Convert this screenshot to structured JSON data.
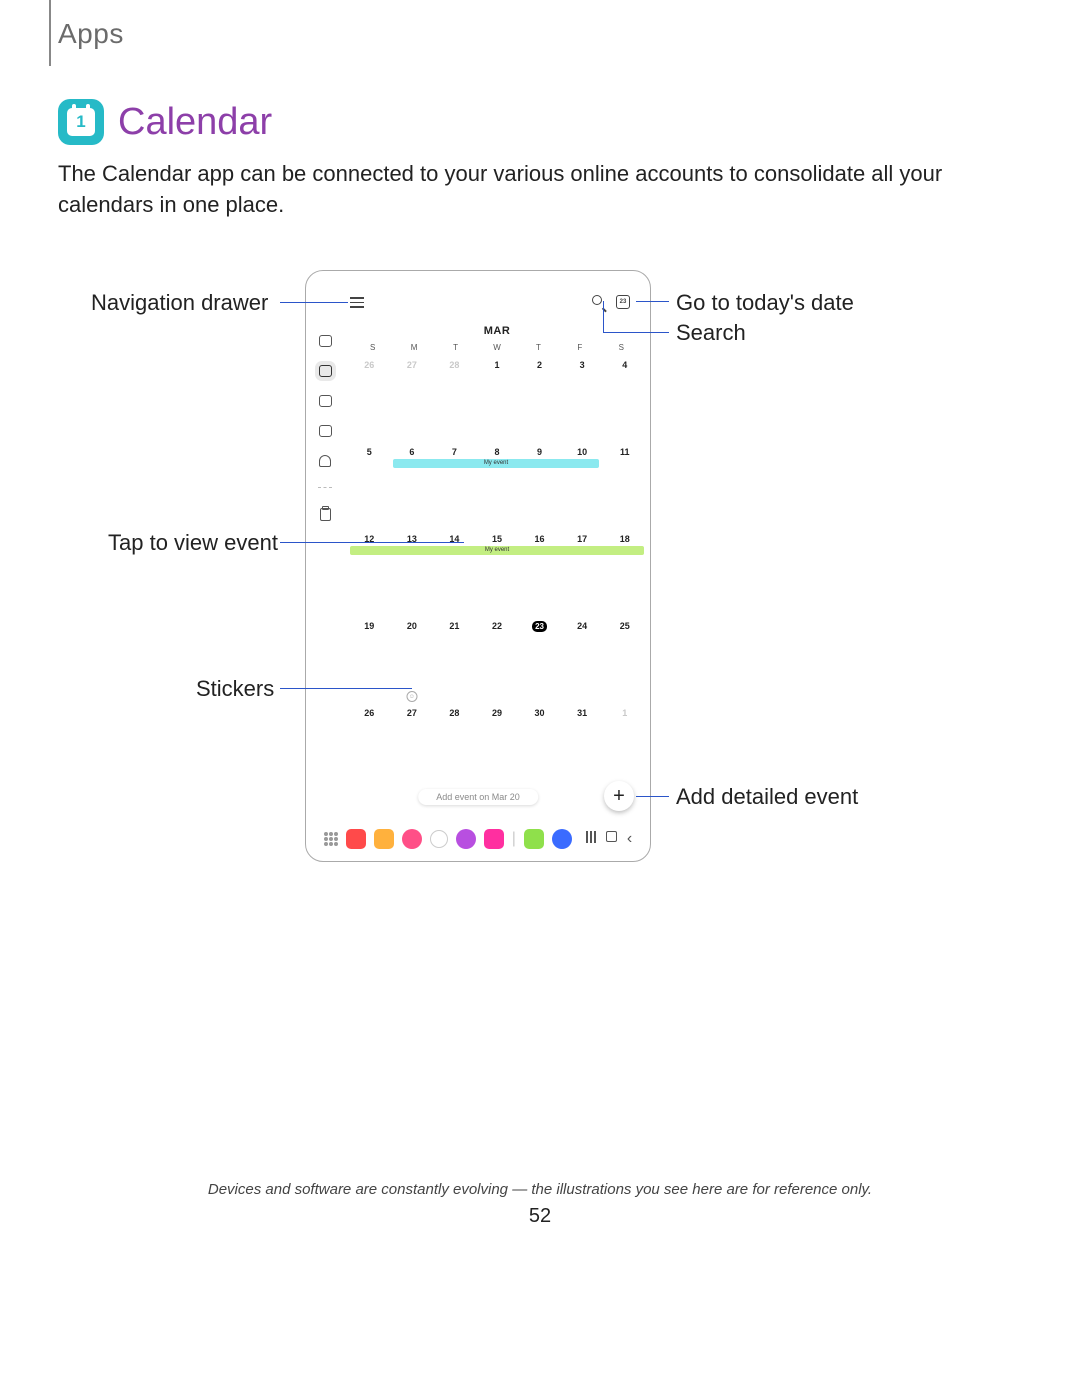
{
  "page": {
    "breadcrumb": "Apps",
    "title": "Calendar",
    "icon_digit": "1",
    "intro": "The Calendar app can be connected to your various online accounts to consolidate all your calendars in one place.",
    "footnote": "Devices and software are constantly evolving — the illustrations you see here are for reference only.",
    "number": "52"
  },
  "callouts": {
    "nav_drawer": "Navigation drawer",
    "tap_view": "Tap to view event",
    "stickers": "Stickers",
    "today": "Go to today's date",
    "search": "Search",
    "add_detailed": "Add detailed event"
  },
  "calendar": {
    "month": "MAR",
    "today_badge": "23",
    "day_headers": [
      "S",
      "M",
      "T",
      "W",
      "T",
      "F",
      "S"
    ],
    "weeks": [
      [
        {
          "d": "26",
          "dim": true
        },
        {
          "d": "27",
          "dim": true
        },
        {
          "d": "28",
          "dim": true
        },
        {
          "d": "1"
        },
        {
          "d": "2"
        },
        {
          "d": "3"
        },
        {
          "d": "4"
        }
      ],
      [
        {
          "d": "5"
        },
        {
          "d": "6"
        },
        {
          "d": "7"
        },
        {
          "d": "8"
        },
        {
          "d": "9"
        },
        {
          "d": "10"
        },
        {
          "d": "11"
        }
      ],
      [
        {
          "d": "12"
        },
        {
          "d": "13"
        },
        {
          "d": "14"
        },
        {
          "d": "15"
        },
        {
          "d": "16"
        },
        {
          "d": "17"
        },
        {
          "d": "18"
        }
      ],
      [
        {
          "d": "19"
        },
        {
          "d": "20"
        },
        {
          "d": "21"
        },
        {
          "d": "22"
        },
        {
          "d": "23",
          "today": true
        },
        {
          "d": "24"
        },
        {
          "d": "25"
        }
      ],
      [
        {
          "d": "26"
        },
        {
          "d": "27"
        },
        {
          "d": "28"
        },
        {
          "d": "29"
        },
        {
          "d": "30"
        },
        {
          "d": "31"
        },
        {
          "d": "1",
          "dim": true
        }
      ]
    ],
    "event_label_1": "My event",
    "event_label_2": "My event",
    "add_pill": "Add event on Mar 20",
    "fab": "+"
  }
}
